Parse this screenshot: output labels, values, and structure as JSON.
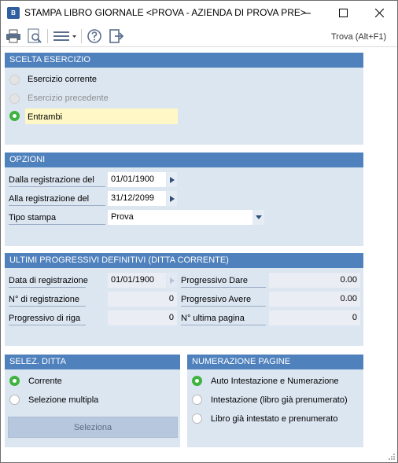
{
  "window": {
    "title": "STAMPA LIBRO GIORNALE <PROVA - AZIENDA DI PROVA PRE>",
    "app_icon_text": "B"
  },
  "toolbar": {
    "search_label": "Trova (Alt+F1)",
    "icons": [
      "print-icon",
      "print-preview-icon",
      "menu-icon",
      "help-icon",
      "exit-icon"
    ]
  },
  "scelta_esercizio": {
    "title": "SCELTA ESERCIZIO",
    "options": [
      {
        "label": "Esercizio corrente",
        "state": "disabled"
      },
      {
        "label": "Esercizio precedente",
        "state": "disabled"
      },
      {
        "label": "Entrambi",
        "state": "selected"
      }
    ]
  },
  "opzioni": {
    "title": "OPZIONI",
    "dalla_label": "Dalla registrazione del",
    "dalla_value": "01/01/1900",
    "alla_label": "Alla registrazione del",
    "alla_value": "31/12/2099",
    "tipo_label": "Tipo stampa",
    "tipo_value": "Prova"
  },
  "progressivi": {
    "title": "ULTIMI PROGRESSIVI DEFINITIVI (DITTA CORRENTE)",
    "data_label": "Data di registrazione",
    "data_value": "01/01/1900",
    "nreg_label": "N° di registrazione",
    "nreg_value": "0",
    "riga_label": "Progressivo di riga",
    "riga_value": "0",
    "dare_label": "Progressivo Dare",
    "dare_value": "0.00",
    "avere_label": "Progressivo Avere",
    "avere_value": "0.00",
    "pagina_label": "N° ultima pagina",
    "pagina_value": "0"
  },
  "selez_ditta": {
    "title": "SELEZ. DITTA",
    "options": [
      {
        "label": "Corrente",
        "state": "selected"
      },
      {
        "label": "Selezione multipla",
        "state": "unselected"
      }
    ],
    "button_label": "Seleziona"
  },
  "numerazione": {
    "title": "NUMERAZIONE PAGINE",
    "options": [
      {
        "label": "Auto Intestazione e Numerazione",
        "state": "selected"
      },
      {
        "label": "Intestazione (libro già prenumerato)",
        "state": "unselected"
      },
      {
        "label": "Libro già intestato e prenumerato",
        "state": "unselected"
      }
    ]
  },
  "colors": {
    "panel_header": "#4f81bd",
    "panel_bg": "#dce6f1",
    "selected_radio": "#3fb33f",
    "highlight": "#fff8c6"
  }
}
